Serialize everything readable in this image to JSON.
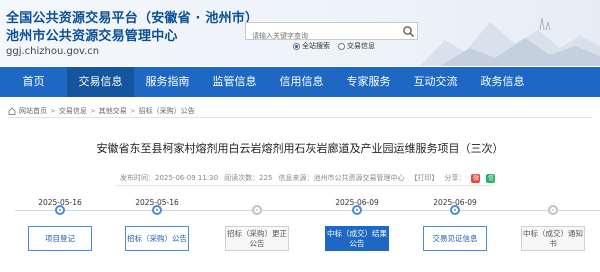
{
  "header": {
    "title_line1": "全国公共资源交易平台（安徽省 · 池州市）",
    "title_line2": "池州市公共资源交易管理中心",
    "url": "ggj.chizhou.gov.cn"
  },
  "search": {
    "placeholder": "请输入关键字查询",
    "options": [
      "全站搜索",
      "交易信息"
    ],
    "selected": "全站搜索"
  },
  "nav": {
    "items": [
      "首页",
      "交易信息",
      "服务指南",
      "监管信息",
      "信用信息",
      "专家服务",
      "互动交流",
      "政务信息"
    ],
    "active": "交易信息"
  },
  "breadcrumb": [
    "网站首页",
    "交易信息",
    "其他交易",
    "招标（采购）公告"
  ],
  "article": {
    "title": "安徽省东至县柯家村熔剂用白云岩熔剂用石灰岩廊道及产业园运维服务项目（三次）",
    "publish_label": "发布时间：",
    "publish_time": "2025-06-09 11:30",
    "views_label": "阅读次数：",
    "views": "225",
    "source_label": "信息来源：",
    "source": "池州市公共资源交易管理中心",
    "print_label": "【打印】",
    "share_label": "分享："
  },
  "timeline": {
    "steps": [
      {
        "date": "2025-05-16",
        "label_lines": [
          "项目登记"
        ],
        "state": "outline"
      },
      {
        "date": "2025-05-16",
        "label_lines": [
          "招标（采购）公告"
        ],
        "state": "outline"
      },
      {
        "date": "",
        "label_lines": [
          "招标（采购）更正",
          "公告"
        ],
        "state": "grey"
      },
      {
        "date": "2025-06-09",
        "label_lines": [
          "中标（成交）结果",
          "公告"
        ],
        "state": "filled"
      },
      {
        "date": "2025-06-09",
        "label_lines": [
          "交易见证信息"
        ],
        "state": "outline"
      },
      {
        "date": "",
        "label_lines": [
          "中标（成交）通知",
          "书"
        ],
        "state": "grey"
      }
    ]
  },
  "colors": {
    "brand_blue": "#1e68c4",
    "title_blue": "#0a4f97",
    "nav_active": "#15549f"
  }
}
